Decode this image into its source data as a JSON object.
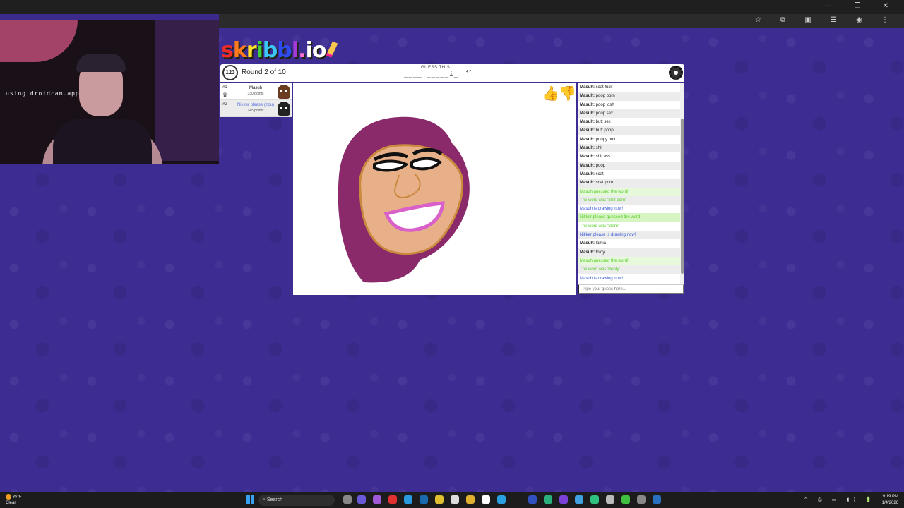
{
  "window": {
    "controls": [
      "—",
      "❐",
      "✕"
    ]
  },
  "toolbar": {
    "icons": [
      "star-icon",
      "extensions-icon",
      "cast-icon",
      "menu-icon"
    ],
    "glyphs": "☆ ⧉ ▣ ☰ ◉ ⋮"
  },
  "webcam": {
    "label": "using droidcam.app"
  },
  "logo": {
    "letters": [
      "s",
      "k",
      "r",
      "i",
      "b",
      "b",
      "l",
      ".",
      "i",
      "o",
      "!"
    ]
  },
  "game": {
    "clock_value": "123",
    "round_text": "Round 2 of 10",
    "guess_label": "GUESS THIS",
    "guess_pattern": "____ _____i_",
    "word_lengths": "4 7"
  },
  "players": [
    {
      "rank": "#1",
      "name": "Masuh",
      "points": "330 points",
      "crown": "♛"
    },
    {
      "rank": "#2",
      "name": "Nikker please (You)",
      "points": "145 points"
    }
  ],
  "chat": {
    "messages": [
      {
        "who": "Masuh:",
        "text": "scat fuck",
        "type": "normal"
      },
      {
        "who": "Masuh:",
        "text": "poop porn",
        "type": "normal"
      },
      {
        "who": "Masuh:",
        "text": "poop josh",
        "type": "normal"
      },
      {
        "who": "Masuh:",
        "text": "poop sex",
        "type": "normal"
      },
      {
        "who": "Masuh:",
        "text": "butt sex",
        "type": "normal"
      },
      {
        "who": "Masuh:",
        "text": "butt poop",
        "type": "normal"
      },
      {
        "who": "Masuh:",
        "text": "poopy butt",
        "type": "normal"
      },
      {
        "who": "Masuh:",
        "text": "shit",
        "type": "normal"
      },
      {
        "who": "Masuh:",
        "text": "shit ass",
        "type": "normal"
      },
      {
        "who": "Masuh:",
        "text": "poop",
        "type": "normal"
      },
      {
        "who": "Masuh:",
        "text": "scat",
        "type": "normal"
      },
      {
        "who": "Masuh:",
        "text": "scat porn",
        "type": "normal"
      },
      {
        "who": "",
        "text": "Masuh guessed the word!",
        "type": "guessed"
      },
      {
        "who": "",
        "text": "The word was 'Shit porn'",
        "type": "word"
      },
      {
        "who": "",
        "text": "Masuh is drawing now!",
        "type": "drawing"
      },
      {
        "who": "",
        "text": "Nikker please guessed the word!",
        "type": "guessed"
      },
      {
        "who": "",
        "text": "The word was 'Slam'",
        "type": "word"
      },
      {
        "who": "",
        "text": "Nikker please is drawing now!",
        "type": "drawing"
      },
      {
        "who": "Masuh:",
        "text": "lamia",
        "type": "normal"
      },
      {
        "who": "Masuh:",
        "text": "foidy",
        "type": "normal"
      },
      {
        "who": "",
        "text": "Masuh guessed the word!",
        "type": "guessed"
      },
      {
        "who": "",
        "text": "The word was 'Booty'",
        "type": "word"
      },
      {
        "who": "",
        "text": "Masuh is drawing now!",
        "type": "drawing"
      }
    ],
    "input_placeholder": "Type your guess here..."
  },
  "taskbar": {
    "weather_temp": "35°F",
    "weather_desc": "Clear",
    "search_label": "Search",
    "time": "9:19 PM",
    "date": "1/4/2026",
    "tray_glyphs": "⌃ ⎙ ▭ ◖) 🔋"
  },
  "colors": {
    "background": "#3d2c92",
    "guessed_text": "#56ce27",
    "drawing_text": "#3a5ad8",
    "hair": "#8a2a6a",
    "skin": "#e8b089",
    "mouth": "#d960c8"
  }
}
